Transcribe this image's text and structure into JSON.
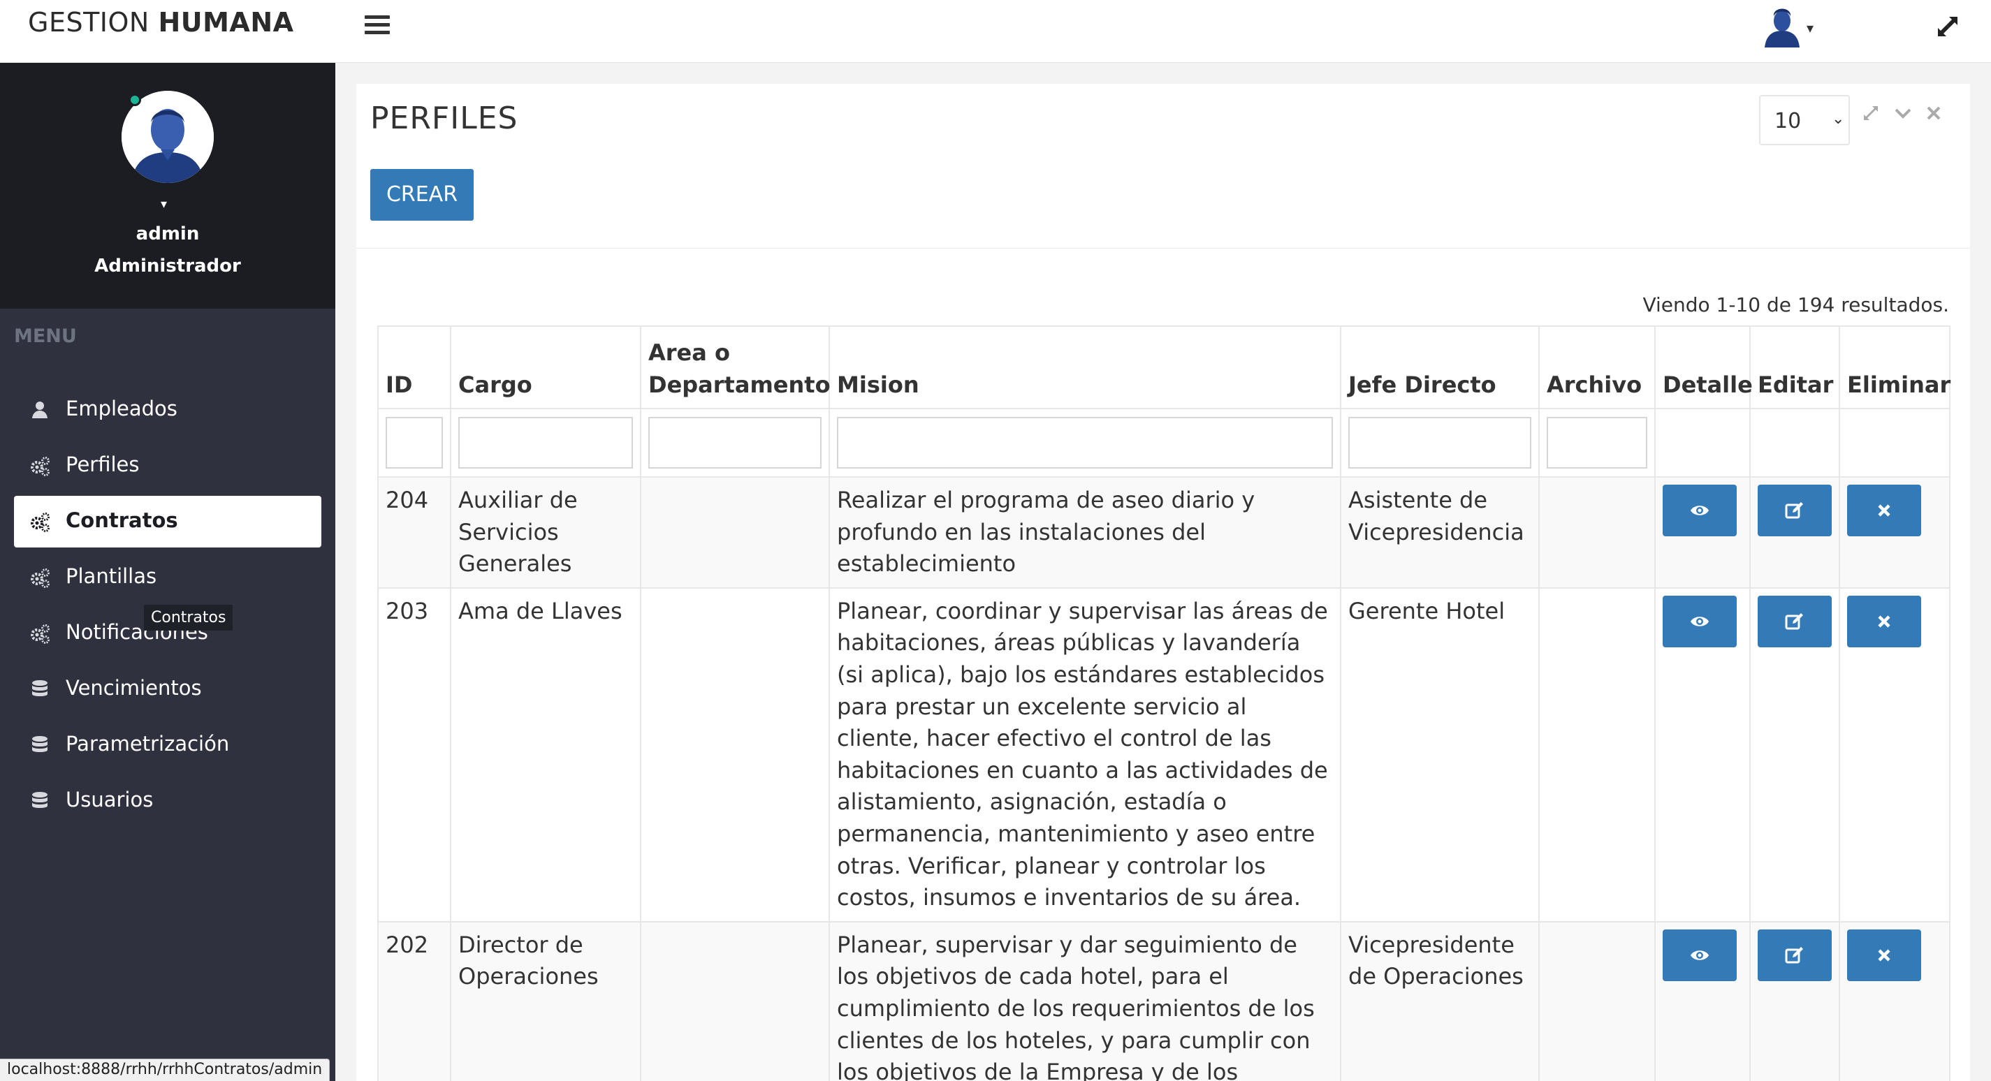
{
  "app": {
    "brand_light": "GESTION",
    "brand_bold": "HUMANA"
  },
  "sidebar": {
    "user_name": "admin",
    "user_role": "Administrador",
    "menu_header": "MENU",
    "items": [
      {
        "label": "Empleados",
        "icon": "user-icon"
      },
      {
        "label": "Perfiles",
        "icon": "cogs-icon"
      },
      {
        "label": "Contratos",
        "icon": "cogs-icon",
        "active": true
      },
      {
        "label": "Plantillas",
        "icon": "cogs-icon"
      },
      {
        "label": "Notificaciones",
        "icon": "cogs-icon"
      },
      {
        "label": "Vencimientos",
        "icon": "database-icon"
      },
      {
        "label": "Parametrización",
        "icon": "database-icon"
      },
      {
        "label": "Usuarios",
        "icon": "database-icon"
      }
    ],
    "tooltip": "Contratos"
  },
  "panel": {
    "title": "PERFILES",
    "page_size": "10",
    "create_label": "CREAR",
    "summary": "Viendo 1-10 de 194 resultados."
  },
  "table": {
    "columns": [
      "ID",
      "Cargo",
      "Area o Departamento",
      "Mision",
      "Jefe Directo",
      "Archivo",
      "Detalle",
      "Editar",
      "Eliminar"
    ],
    "rows": [
      {
        "id": "204",
        "cargo": "Auxiliar de Servicios Generales",
        "area": "",
        "mision": "Realizar el programa de aseo diario y profundo en las instalaciones del establecimiento",
        "jefe": "Asistente de Vicepresidencia",
        "archivo": ""
      },
      {
        "id": "203",
        "cargo": "Ama de Llaves",
        "area": "",
        "mision": "Planear, coordinar y supervisar las áreas de habitaciones, áreas públicas y lavandería (si aplica), bajo los estándares establecidos para prestar un excelente servicio al cliente, hacer efectivo el control de las habitaciones en cuanto a las actividades de alistamiento, asignación, estadía o permanencia, mantenimiento y aseo entre otras. Verificar, planear y controlar los costos, insumos e inventarios de su área.",
        "jefe": "Gerente Hotel",
        "archivo": ""
      },
      {
        "id": "202",
        "cargo": "Director de Operaciones",
        "area": "",
        "mision": "Planear, supervisar y dar seguimiento de los objetivos de cada hotel, para el cumplimiento de los requerimientos de los clientes de los hoteles, y para cumplir con los objetivos de la Empresa y de los propietarios con eficiencia.",
        "jefe": "Vicepresidente de Operaciones",
        "archivo": ""
      }
    ]
  },
  "status_url": "localhost:8888/rrhh/rrhhContratos/admin",
  "colors": {
    "primary": "#337ab7",
    "sidebar_bg": "#2f323e",
    "profile_bg": "#1b1d22",
    "online": "#1ab394"
  }
}
